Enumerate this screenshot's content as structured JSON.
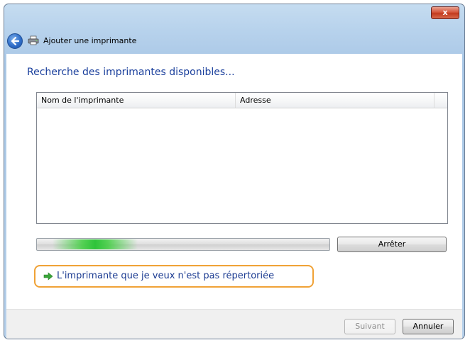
{
  "window": {
    "title": "Ajouter une imprimante",
    "close_label": "x"
  },
  "heading": "Recherche des imprimantes disponibles...",
  "list": {
    "columns": [
      "Nom de l'imprimante",
      "Adresse"
    ]
  },
  "progress": {
    "state": "indeterminate"
  },
  "buttons": {
    "stop": "Arrêter",
    "next": "Suivant",
    "cancel": "Annuler"
  },
  "link": {
    "text": "L'imprimante que je veux n'est pas répertoriée"
  },
  "icons": {
    "back": "back-arrow-icon",
    "printer": "printer-icon",
    "link_arrow": "green-arrow-icon",
    "close": "close-icon"
  },
  "colors": {
    "heading": "#1a3f9c",
    "link": "#1c3c92",
    "highlight_border": "#f0a236",
    "progress_fill": "#2ec43a"
  }
}
